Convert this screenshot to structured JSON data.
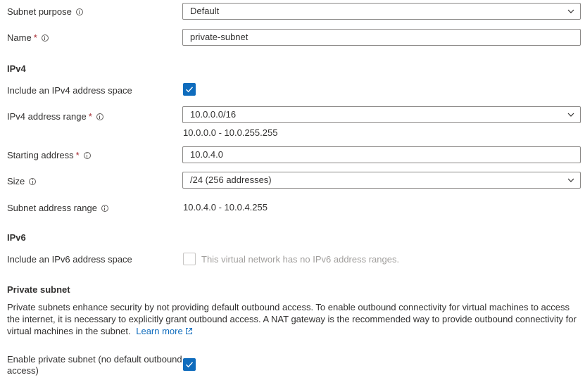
{
  "subnet_purpose": {
    "label": "Subnet purpose",
    "value": "Default"
  },
  "name": {
    "label": "Name",
    "required_mark": "*",
    "value": "private-subnet"
  },
  "ipv4": {
    "heading": "IPv4",
    "include_label": "Include an IPv4 address space",
    "include_checked": true,
    "range_label": "IPv4 address range",
    "required_mark": "*",
    "range_value": "10.0.0.0/16",
    "range_hint": "10.0.0.0 - 10.0.255.255",
    "starting_label": "Starting address",
    "starting_value": "10.0.4.0",
    "size_label": "Size",
    "size_value": "/24 (256 addresses)",
    "subnet_range_label": "Subnet address range",
    "subnet_range_value": "10.0.4.0 - 10.0.4.255"
  },
  "ipv6": {
    "heading": "IPv6",
    "include_label": "Include an IPv6 address space",
    "include_checked": false,
    "disabled_note": "This virtual network has no IPv6 address ranges."
  },
  "private_subnet": {
    "heading": "Private subnet",
    "description": "Private subnets enhance security by not providing default outbound access. To enable outbound connectivity for virtual machines to access the internet, it is necessary to explicitly grant outbound access. A NAT gateway is the recommended way to provide outbound connectivity for virtual machines in the subnet.",
    "learn_more": "Learn more",
    "enable_label_line1": "Enable private subnet (no default outbound",
    "enable_label_line2": "access)",
    "enable_checked": true
  },
  "colors": {
    "accent": "#0f6cbd",
    "required": "#a4262c",
    "disabled_text": "#a19f9d"
  }
}
